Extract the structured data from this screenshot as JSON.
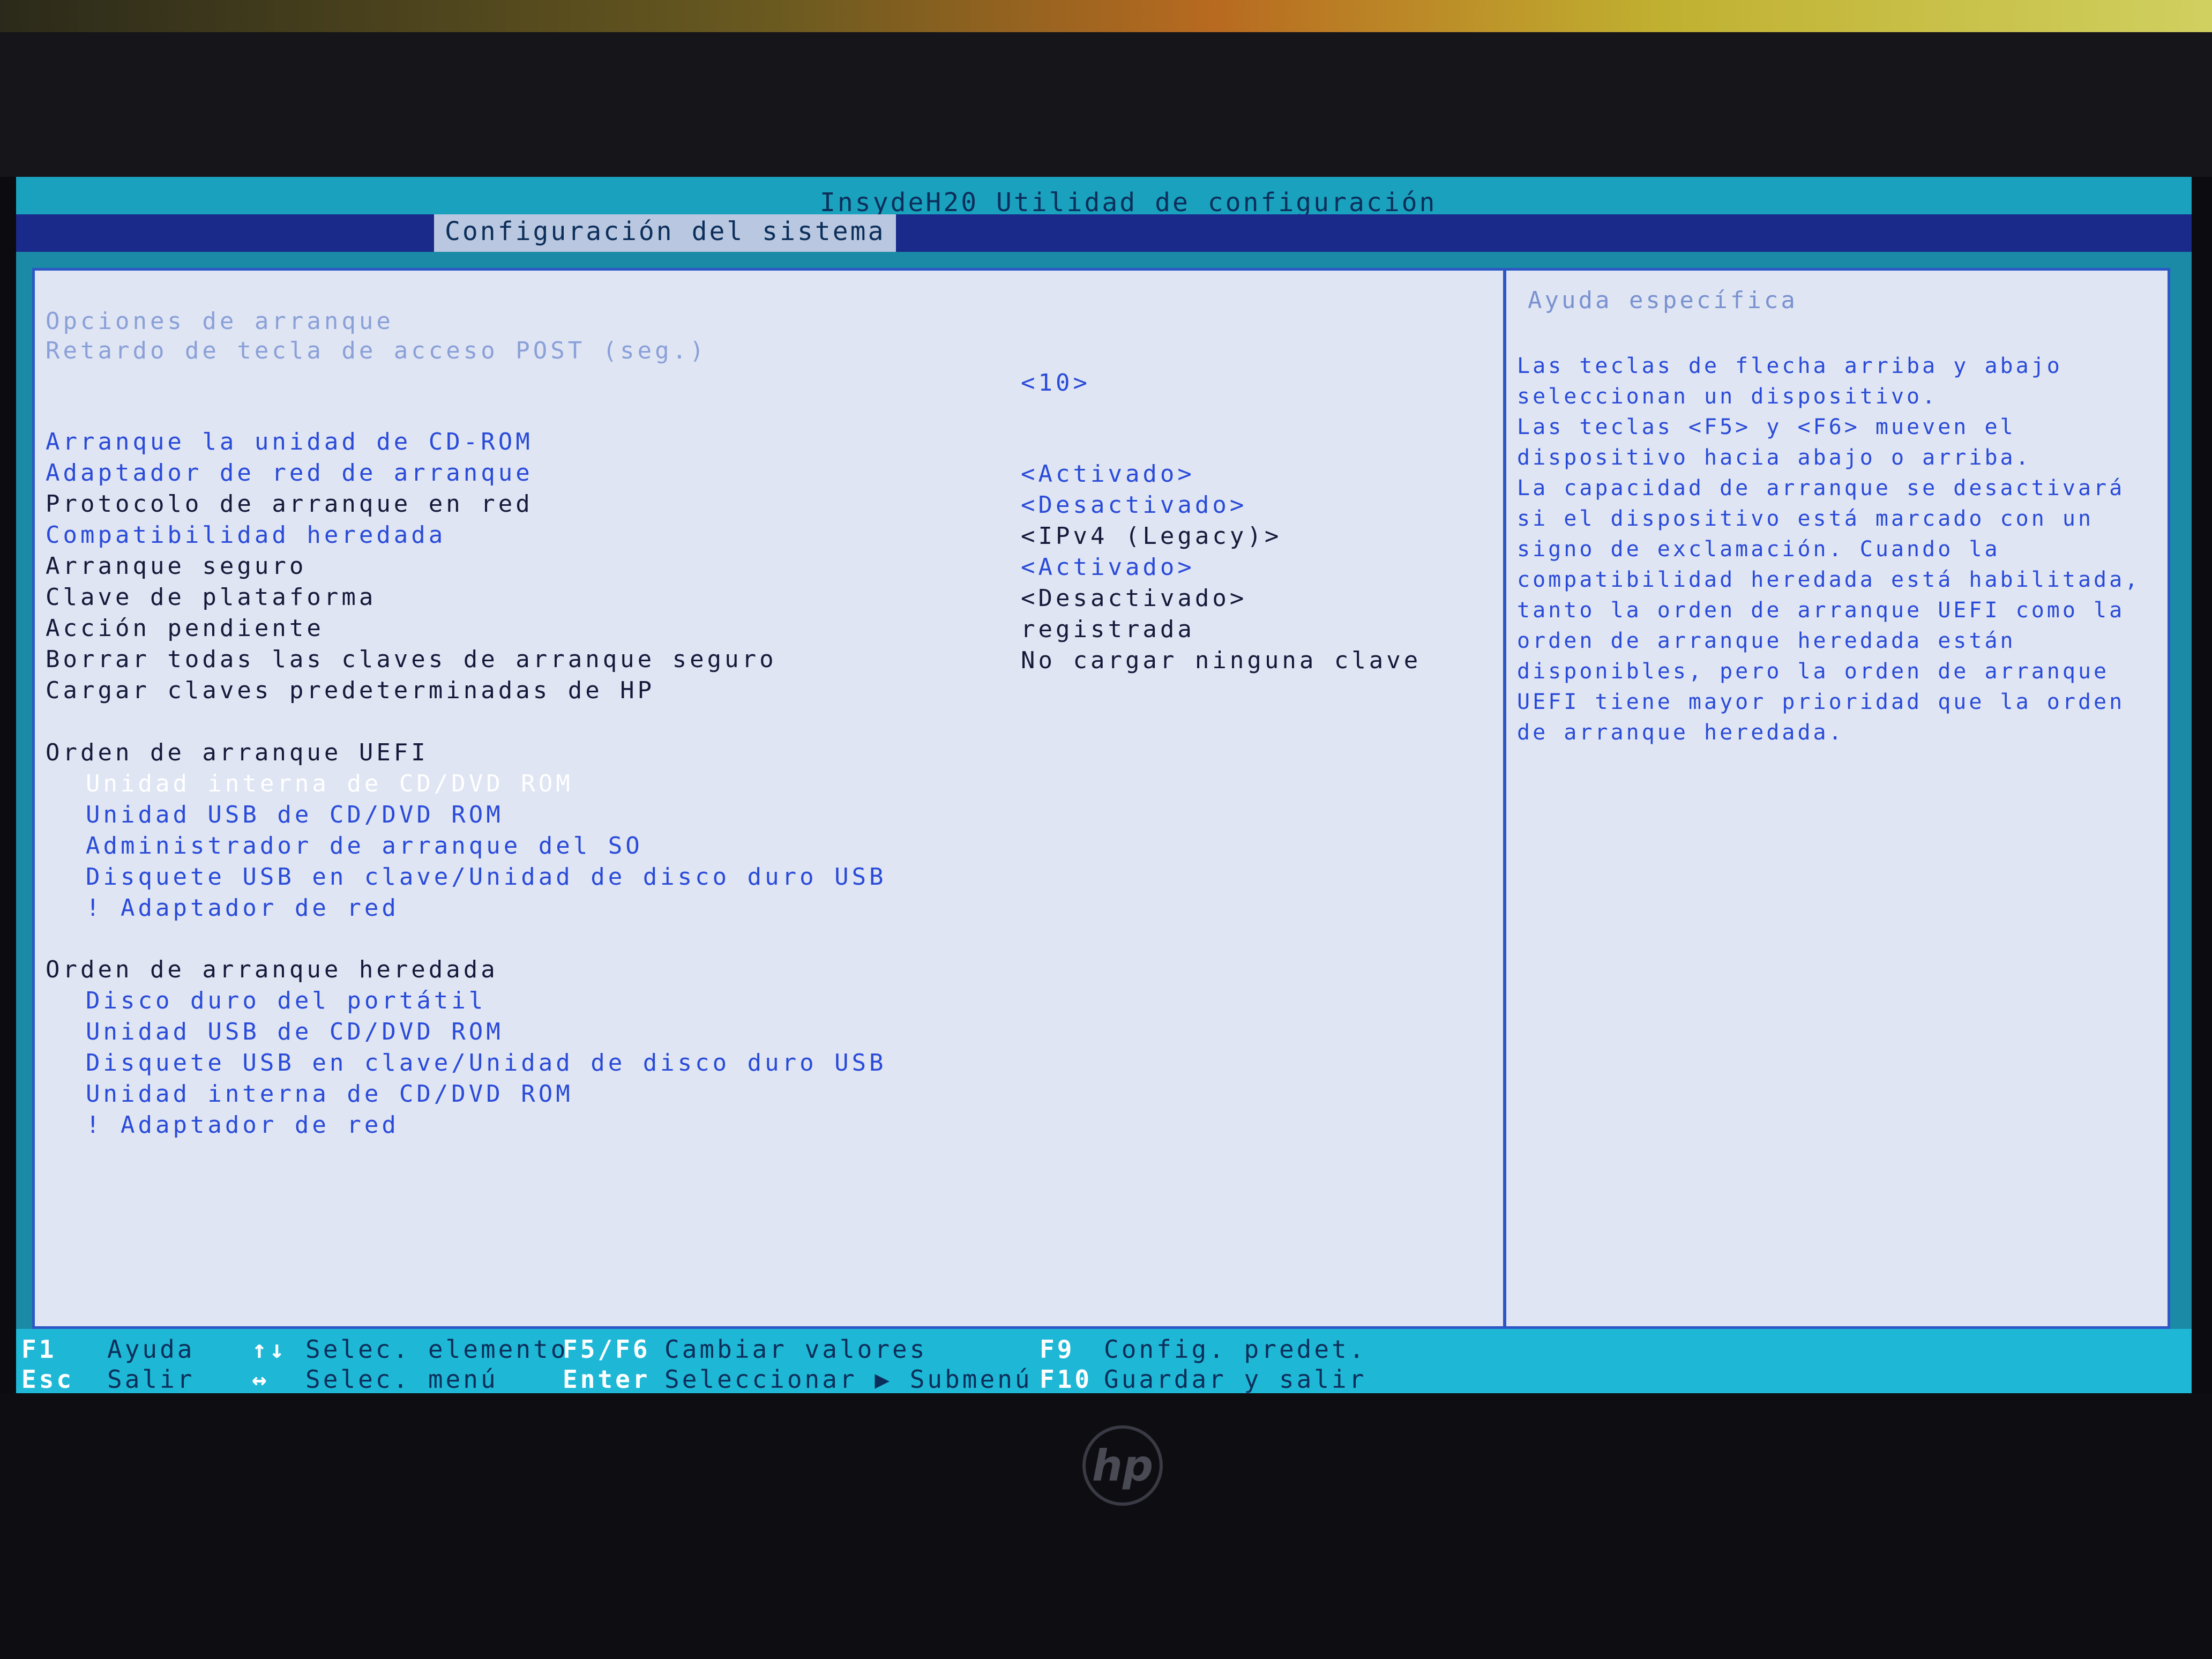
{
  "app": {
    "title": "InsydeH20 Utilidad de configuración",
    "tab": "Configuración del sistema"
  },
  "settings": {
    "section_title": "Opciones de arranque",
    "post_delay_label": "Retardo de tecla de acceso POST (seg.)",
    "post_delay_value": "<10>",
    "cdrom_boot_label": "Arranque la unidad de CD-ROM",
    "cdrom_boot_value": "<Activado>",
    "network_adapter_boot_label": "Adaptador de red de arranque",
    "network_adapter_boot_value": "<Desactivado>",
    "network_protocol_label": "Protocolo de arranque en red",
    "network_protocol_value": "<IPv4 (Legacy)>",
    "legacy_support_label": "Compatibilidad heredada",
    "legacy_support_value": "<Activado>",
    "secure_boot_label": "Arranque seguro",
    "secure_boot_value": "<Desactivado>",
    "platform_key_label": "Clave de plataforma",
    "platform_key_value": "registrada",
    "pending_action_label": "Acción pendiente",
    "pending_action_value": "No cargar ninguna clave",
    "clear_keys_label": "Borrar todas las claves de arranque seguro",
    "load_hp_keys_label": "Cargar claves predeterminadas de HP"
  },
  "uefi_boot_order": {
    "title": "Orden de arranque UEFI",
    "items": [
      "Unidad interna de CD/DVD ROM",
      "Unidad USB de CD/DVD ROM",
      "Administrador de arranque del SO",
      "Disquete USB en clave/Unidad de disco duro USB",
      "! Adaptador de red"
    ]
  },
  "legacy_boot_order": {
    "title": "Orden de arranque heredada",
    "items": [
      "Disco duro del portátil",
      "Unidad USB de CD/DVD ROM",
      "Disquete USB en clave/Unidad de disco duro USB",
      "Unidad interna de CD/DVD ROM",
      "! Adaptador de red"
    ]
  },
  "help": {
    "title": "Ayuda específica",
    "text": "Las teclas de flecha arriba y abajo\nseleccionan un dispositivo.\n Las teclas <F5> y <F6> mueven el\ndispositivo hacia abajo o arriba.\n La capacidad de arranque se desactivará\nsi el dispositivo está marcado con un\nsigno de exclamación. Cuando la\ncompatibilidad heredada está habilitada,\ntanto la orden de arranque UEFI como la\norden de arranque heredada están\ndisponibles, pero la orden de arranque\nUEFI tiene mayor prioridad que la orden\nde arranque heredada."
  },
  "footer": {
    "f1_key": "F1",
    "f1_label": "Ayuda",
    "esc_key": "Esc",
    "esc_label": "Salir",
    "updown_key": "↑↓",
    "updown_label": "Selec. elemento",
    "leftright_key": "↔",
    "leftright_label": "Selec. menú",
    "f5f6_key": "F5/F6",
    "f5f6_label": "Cambiar valores",
    "enter_key": "Enter",
    "enter_label": "Seleccionar ▶ Submenú",
    "f9_key": "F9",
    "f9_label": "Config. predet.",
    "f10_key": "F10",
    "f10_label": "Guardar y salir"
  },
  "bezel": {
    "brand": "hp"
  }
}
